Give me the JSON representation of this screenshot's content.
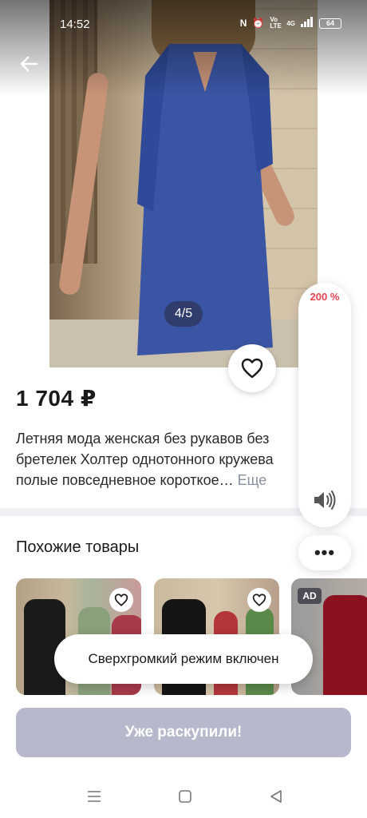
{
  "status_bar": {
    "time": "14:52",
    "network": "4G",
    "volte": "Vo LTE",
    "battery": "64"
  },
  "product": {
    "image_counter": "4/5",
    "price": "1 704 ₽",
    "description": "Летняя мода женская без рукавов без бретелек Холтер однотонного кружева полые повседневное короткое…",
    "more_link": "Еще"
  },
  "similar": {
    "title": "Похожие товары",
    "ad_badge": "AD"
  },
  "volume": {
    "level_text": "200 %"
  },
  "toast": {
    "message": "Сверхгромкий режим включен"
  },
  "actions": {
    "more_dots": "•••",
    "buy_label": "Уже раскупили!"
  },
  "colors": {
    "accent_red": "#e8424f",
    "disabled_button": "#b7b8cb",
    "dress_blue": "#3a55a4"
  }
}
